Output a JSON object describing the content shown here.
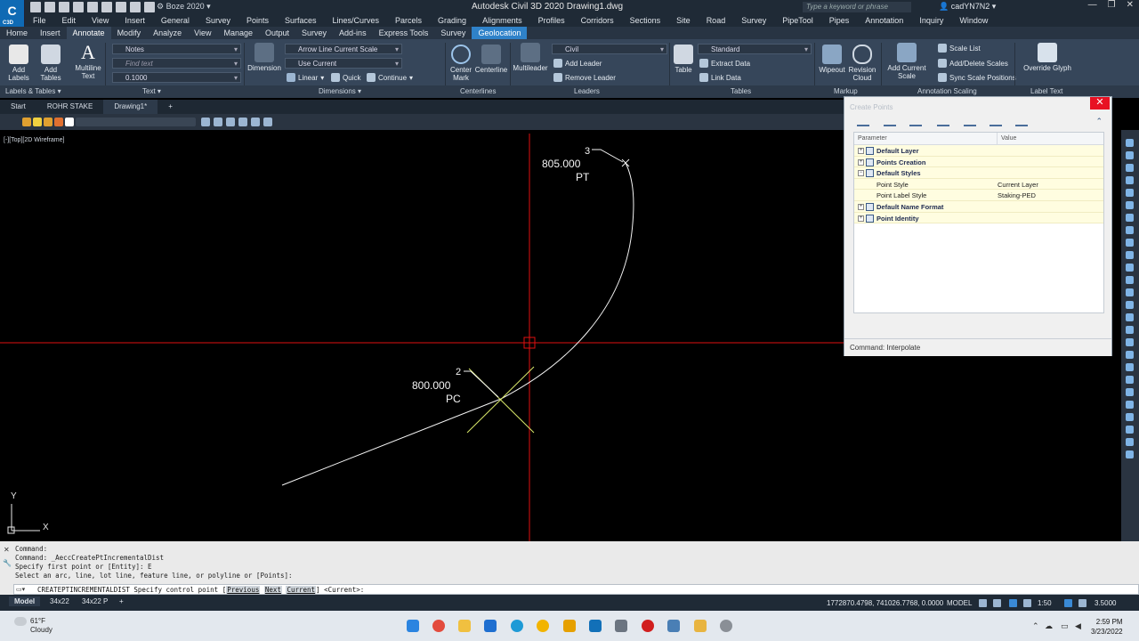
{
  "window": {
    "app_badge": "C3D",
    "workspace": "Boze 2020",
    "title": "Autodesk Civil 3D 2020   Drawing1.dwg",
    "search_placeholder": "Type a keyword or phrase",
    "user": "cadYN7N2",
    "controls": [
      "—",
      "❐",
      "✕"
    ]
  },
  "menubar": [
    "File",
    "Edit",
    "View",
    "Insert",
    "General",
    "Survey",
    "Points",
    "Surfaces",
    "Lines/Curves",
    "Parcels",
    "Grading",
    "Alignments",
    "Profiles",
    "Corridors",
    "Sections",
    "Site",
    "Road",
    "Survey",
    "PipeTool",
    "Pipes",
    "Annotation",
    "Inquiry",
    "Window"
  ],
  "ribbon_tabs": [
    {
      "label": "Home",
      "state": "normal"
    },
    {
      "label": "Insert",
      "state": "normal"
    },
    {
      "label": "Annotate",
      "state": "active"
    },
    {
      "label": "Modify",
      "state": "normal"
    },
    {
      "label": "Analyze",
      "state": "normal"
    },
    {
      "label": "View",
      "state": "normal"
    },
    {
      "label": "Manage",
      "state": "normal"
    },
    {
      "label": "Output",
      "state": "normal"
    },
    {
      "label": "Survey",
      "state": "normal"
    },
    {
      "label": "Add-ins",
      "state": "normal"
    },
    {
      "label": "Express Tools",
      "state": "normal"
    },
    {
      "label": "Survey",
      "state": "normal"
    },
    {
      "label": "Geolocation",
      "state": "highlight"
    }
  ],
  "ribbon": {
    "add_labels": "Add Labels",
    "add_tables": "Add Tables",
    "multiline_text": "Multiline Text",
    "text_style": "Notes",
    "find_text": "Find text",
    "text_height": "0.1000",
    "dimension": "Dimension",
    "dim_style": "Arrow Line Current Scale",
    "dim_layer": "Use Current",
    "linear": "Linear",
    "quick": "Quick",
    "continue": "Continue",
    "center_mark": "Center Mark",
    "centerline": "Centerline",
    "multileader": "Multileader",
    "leader_style": "Civil",
    "add_leader": "Add Leader",
    "remove_leader": "Remove Leader",
    "table": "Table",
    "table_style": "Standard",
    "extract_data": "Extract Data",
    "link_data": "Link Data",
    "wipeout": "Wipeout",
    "revision_cloud": "Revision Cloud",
    "add_current_scale": "Add Current Scale",
    "scale_list": "Scale List",
    "add_delete_scales": "Add/Delete Scales",
    "sync_scale_positions": "Sync Scale Positions",
    "override_glyph": "Override Glyph",
    "panels": {
      "labels_tables": "Labels & Tables",
      "text": "Text",
      "dimensions": "Dimensions",
      "centerlines": "Centerlines",
      "leaders": "Leaders",
      "tables": "Tables",
      "markup": "Markup",
      "annotation_scaling": "Annotation Scaling",
      "label_text": "Label Text"
    }
  },
  "file_tabs": [
    {
      "label": "Start",
      "active": false
    },
    {
      "label": "ROHR STAKE",
      "active": false
    },
    {
      "label": "Drawing1*",
      "active": true
    },
    {
      "label": "+",
      "active": false
    }
  ],
  "viewport": {
    "label": "[-][Top][2D Wireframe]",
    "axis_y": "Y",
    "axis_x": "X",
    "pt3_number": "3",
    "pt3_station": "805.000",
    "pt3_desc": "PT",
    "pt2_number": "2",
    "pt2_station": "800.000",
    "pt2_desc": "PC",
    "crosshair_color": "#e01010",
    "geometry_color": "#f4f4f4",
    "marker_color": "#d9e86a"
  },
  "palette": {
    "title": "Create Points",
    "col_parameter": "Parameter",
    "col_value": "Value",
    "rows": [
      {
        "label": "Default Layer",
        "value": "",
        "group": true,
        "expander": "+"
      },
      {
        "label": "Points Creation",
        "value": "",
        "group": true,
        "expander": "+"
      },
      {
        "label": "Default Styles",
        "value": "",
        "group": true,
        "expander": "−"
      },
      {
        "label": "Point Style",
        "value": "Current Layer",
        "group": false,
        "expander": ""
      },
      {
        "label": "Point Label Style",
        "value": "Staking-PED",
        "group": false,
        "expander": ""
      },
      {
        "label": "Default Name Format",
        "value": "",
        "group": true,
        "expander": "+"
      },
      {
        "label": "Point Identity",
        "value": "",
        "group": true,
        "expander": "+"
      }
    ],
    "status": "Command: Interpolate"
  },
  "command": {
    "history": [
      "Command:",
      "Command: _AeccCreatePtIncrementalDist",
      "Specify first point or [Entity]: E",
      "Select an arc, line, lot line, feature line, or polyline or [Points]:"
    ],
    "prompt_prefix": "CREATEPTINCREMENTALDIST Specify control point [",
    "opt_previous": "Previous",
    "opt_next": "Next",
    "opt_current": "Current",
    "prompt_suffix": "] <Current>:"
  },
  "status_bar": {
    "tabs": [
      {
        "label": "Model",
        "active": true
      },
      {
        "label": "34x22",
        "active": false
      },
      {
        "label": "34x22 P",
        "active": false
      },
      {
        "label": "+",
        "active": false
      }
    ],
    "coords": "1772870.4798, 741026.7768, 0.0000",
    "model": "MODEL",
    "scale": "1:50",
    "elevation": "3.5000"
  },
  "taskbar": {
    "temp": "61°F",
    "condition": "Cloudy",
    "time": "2:59 PM",
    "date": "3/23/2022"
  }
}
